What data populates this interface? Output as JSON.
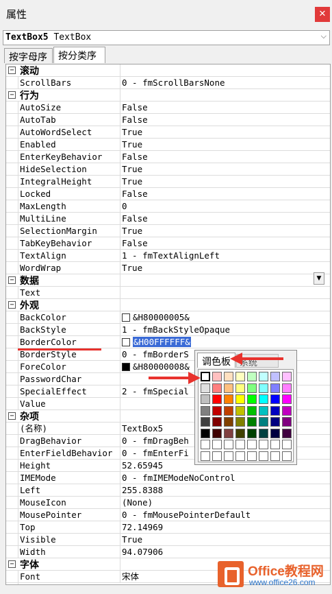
{
  "window": {
    "title": "属性",
    "close_label": "✕"
  },
  "object_selector": {
    "name": "TextBox5",
    "type": "TextBox"
  },
  "tabs": [
    {
      "label": "按字母序"
    },
    {
      "label": "按分类序"
    }
  ],
  "grid": {
    "rows": [
      {
        "kind": "cat",
        "toggle": "−",
        "name": "滚动"
      },
      {
        "kind": "prop",
        "name": "ScrollBars",
        "value": "0 - fmScrollBarsNone"
      },
      {
        "kind": "cat",
        "toggle": "−",
        "name": "行为"
      },
      {
        "kind": "prop",
        "name": "AutoSize",
        "value": "False"
      },
      {
        "kind": "prop",
        "name": "AutoTab",
        "value": "False"
      },
      {
        "kind": "prop",
        "name": "AutoWordSelect",
        "value": "True"
      },
      {
        "kind": "prop",
        "name": "Enabled",
        "value": "True"
      },
      {
        "kind": "prop",
        "name": "EnterKeyBehavior",
        "value": "False"
      },
      {
        "kind": "prop",
        "name": "HideSelection",
        "value": "True"
      },
      {
        "kind": "prop",
        "name": "IntegralHeight",
        "value": "True"
      },
      {
        "kind": "prop",
        "name": "Locked",
        "value": "False"
      },
      {
        "kind": "prop",
        "name": "MaxLength",
        "value": "0"
      },
      {
        "kind": "prop",
        "name": "MultiLine",
        "value": "False"
      },
      {
        "kind": "prop",
        "name": "SelectionMargin",
        "value": "True"
      },
      {
        "kind": "prop",
        "name": "TabKeyBehavior",
        "value": "False"
      },
      {
        "kind": "prop",
        "name": "TextAlign",
        "value": "1 - fmTextAlignLeft"
      },
      {
        "kind": "prop",
        "name": "WordWrap",
        "value": "True"
      },
      {
        "kind": "cat",
        "toggle": "−",
        "name": "数据"
      },
      {
        "kind": "prop",
        "name": "Text",
        "value": ""
      },
      {
        "kind": "cat",
        "toggle": "−",
        "name": "外观"
      },
      {
        "kind": "prop",
        "name": "BackColor",
        "value": "&H80000005&",
        "swatch": "#ffffff"
      },
      {
        "kind": "prop",
        "name": "BackStyle",
        "value": "1 - fmBackStyleOpaque"
      },
      {
        "kind": "prop",
        "name": "BorderColor",
        "value": "&H00FFFFFF&",
        "swatch": "#ffffff",
        "selected": true
      },
      {
        "kind": "prop",
        "name": "BorderStyle",
        "value": "0 - fmBorderS"
      },
      {
        "kind": "prop",
        "name": "ForeColor",
        "value": "&H80000008&",
        "swatch": "#000000"
      },
      {
        "kind": "prop",
        "name": "PasswordChar",
        "value": ""
      },
      {
        "kind": "prop",
        "name": "SpecialEffect",
        "value": "2 - fmSpecial"
      },
      {
        "kind": "prop",
        "name": "Value",
        "value": ""
      },
      {
        "kind": "cat",
        "toggle": "−",
        "name": "杂项"
      },
      {
        "kind": "prop",
        "name": "(名称)",
        "value": "TextBox5"
      },
      {
        "kind": "prop",
        "name": "DragBehavior",
        "value": "0 - fmDragBeh"
      },
      {
        "kind": "prop",
        "name": "EnterFieldBehavior",
        "value": "0 - fmEnterFi"
      },
      {
        "kind": "prop",
        "name": "Height",
        "value": "52.65945"
      },
      {
        "kind": "prop",
        "name": "IMEMode",
        "value": "0 - fmIMEModeNoControl"
      },
      {
        "kind": "prop",
        "name": "Left",
        "value": "255.8388"
      },
      {
        "kind": "prop",
        "name": "MouseIcon",
        "value": "(None)"
      },
      {
        "kind": "prop",
        "name": "MousePointer",
        "value": "0 - fmMousePointerDefault"
      },
      {
        "kind": "prop",
        "name": "Top",
        "value": "72.14969"
      },
      {
        "kind": "prop",
        "name": "Visible",
        "value": "True"
      },
      {
        "kind": "prop",
        "name": "Width",
        "value": "94.07906"
      },
      {
        "kind": "cat",
        "toggle": "−",
        "name": "字体"
      },
      {
        "kind": "prop",
        "name": "Font",
        "value": "宋体"
      }
    ]
  },
  "color_popup": {
    "tab_palette": "调色板",
    "tab_system": "系统",
    "colors": [
      "#ffffff",
      "#ffc0c0",
      "#ffe0c0",
      "#ffffc0",
      "#c0ffc0",
      "#c0ffff",
      "#c0c0ff",
      "#ffc0ff",
      "#e0e0e0",
      "#ff8080",
      "#ffc080",
      "#ffff80",
      "#80ff80",
      "#80ffff",
      "#8080ff",
      "#ff80ff",
      "#c0c0c0",
      "#ff0000",
      "#ff8000",
      "#ffff00",
      "#00ff00",
      "#00ffff",
      "#0000ff",
      "#ff00ff",
      "#808080",
      "#c00000",
      "#c04000",
      "#c0c000",
      "#00c000",
      "#00c0c0",
      "#0000c0",
      "#c000c0",
      "#404040",
      "#800000",
      "#804000",
      "#808000",
      "#008000",
      "#008080",
      "#000080",
      "#800080",
      "#000000",
      "#400000",
      "#804040",
      "#404000",
      "#004000",
      "#004040",
      "#000040",
      "#400040",
      "#ffffff",
      "#ffffff",
      "#ffffff",
      "#ffffff",
      "#ffffff",
      "#ffffff",
      "#ffffff",
      "#ffffff",
      "#ffffff",
      "#ffffff",
      "#ffffff",
      "#ffffff",
      "#ffffff",
      "#ffffff",
      "#ffffff",
      "#ffffff"
    ]
  },
  "watermark": {
    "line1": "Office教程网",
    "line2": "www.office26.com"
  },
  "accent": "#e8322d",
  "selection_color": "#3a6ad6"
}
